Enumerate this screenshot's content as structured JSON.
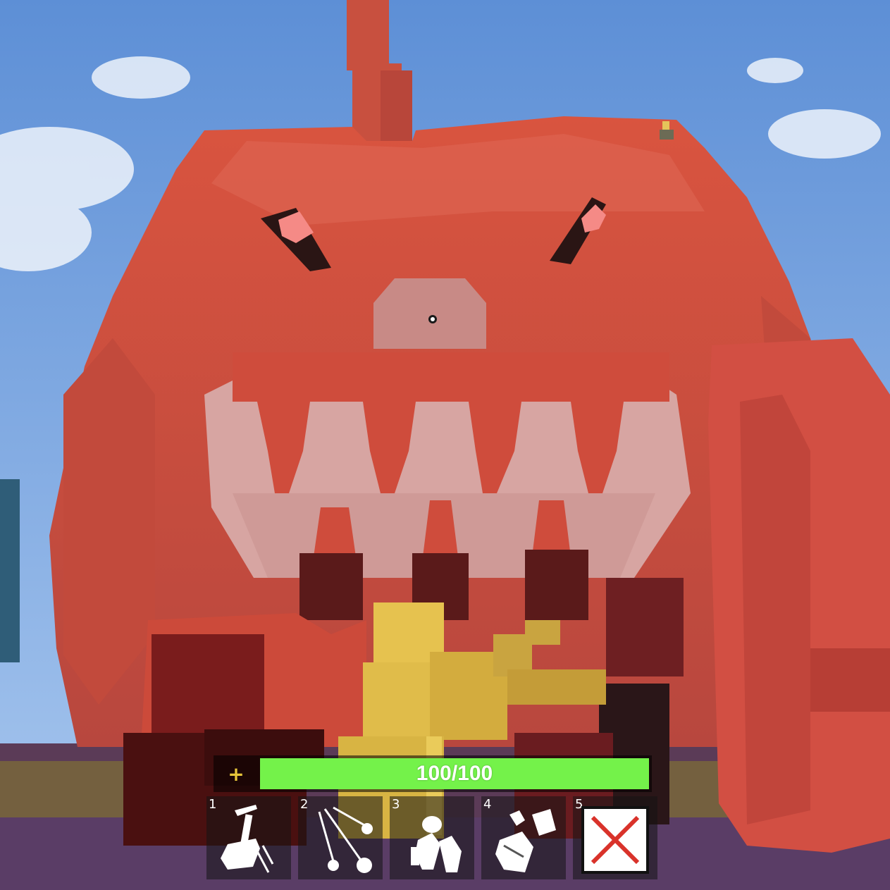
{
  "health": {
    "plus_icon": "+",
    "text": "100/100",
    "current": 100,
    "max": 100,
    "bar_color": "#74f24a"
  },
  "hotbar": {
    "slots": [
      {
        "key": "1",
        "icon": "sword-slash-icon"
      },
      {
        "key": "2",
        "icon": "projectile-spray-icon"
      },
      {
        "key": "3",
        "icon": "bombs-icon"
      },
      {
        "key": "4",
        "icon": "blocks-icon"
      },
      {
        "key": "5",
        "icon": "close-x-icon"
      }
    ]
  },
  "colors": {
    "sky": "#6fa0df",
    "monster": "#d45444",
    "accent_x": "#d9322a"
  }
}
